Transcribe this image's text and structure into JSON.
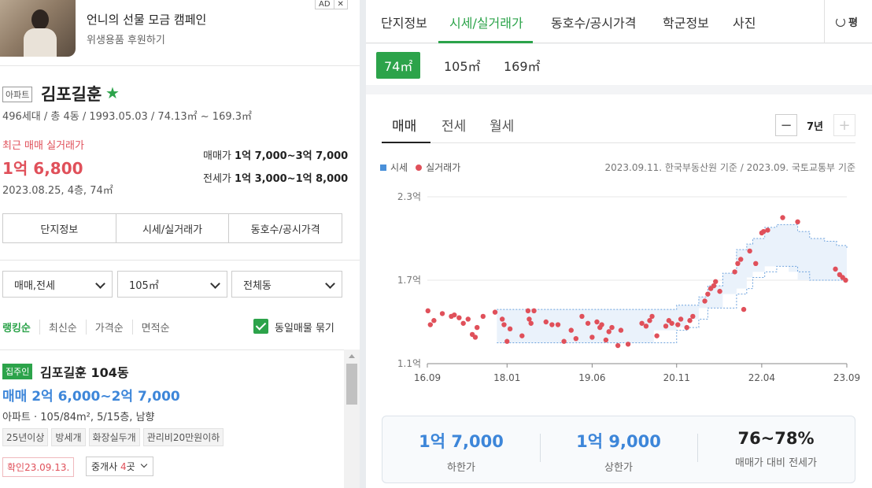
{
  "ad": {
    "title": "언니의 선물 모금 캠페인",
    "subtitle": "위생용품 후원하기",
    "ad_label": "AD",
    "close": "✕"
  },
  "complex": {
    "type_tag": "아파트",
    "name": "김포길훈",
    "star": "★",
    "info": "496세대 / 총 4동 / 1993.05.03 / 74.13㎡ ~ 169.3㎡",
    "recent_label": "최근 매매 실거래가",
    "recent_price": "1억 6,800",
    "recent_date": "2023.08.25, 4층, 74㎡",
    "sale_label": "매매가",
    "sale_range": "1억 7,000~3억 7,000",
    "jeonse_label": "전세가",
    "jeonse_range": "1억 3,000~1억 8,000"
  },
  "section_tabs": [
    "단지정보",
    "시세/실거래가",
    "동호수/공시가격"
  ],
  "filters": {
    "trade": "매매,전세",
    "area": "105㎡",
    "dong": "전체동"
  },
  "sort": {
    "options": [
      "랭킹순",
      "최신순",
      "가격순",
      "면적순"
    ],
    "active": 0,
    "group_label": "동일매물 묶기",
    "group_checked": true
  },
  "listing": {
    "badge": "집주인",
    "title": "김포길훈 104동",
    "price": "매매 2억 6,000~2억 7,000",
    "spec": "아파트 · 105/84m², 5/15층, 남향",
    "chips": [
      "25년이상",
      "방세개",
      "화장실두개",
      "관리비20만원이하"
    ],
    "confirm": "확인23.09.13.",
    "broker_prefix": "중개사 ",
    "broker_count": "4",
    "broker_suffix": "곳"
  },
  "right_tabs": {
    "items": [
      "단지정보",
      "시세/실거래가",
      "동호수/공시가격",
      "학군정보",
      "사진"
    ],
    "active": 1,
    "unit_toggle": "평"
  },
  "areas": {
    "items": [
      "74㎡",
      "105㎡",
      "169㎡"
    ],
    "active": 0
  },
  "chart_panel": {
    "tabs": [
      "매매",
      "전세",
      "월세"
    ],
    "active": 0,
    "minus": "−",
    "period": "7년",
    "plus": "+",
    "legend_price": "시세",
    "legend_trade": "실거래가",
    "source": "2023.09.11. 한국부동산원 기준 / 2023.09. 국토교통부 기준"
  },
  "summary": {
    "low_value": "1억 7,000",
    "low_label": "하한가",
    "high_value": "1억 9,000",
    "high_label": "상한가",
    "ratio_value": "76~78%",
    "ratio_label": "매매가 대비 전세가"
  },
  "colors": {
    "accent": "#2ca34a",
    "price_red": "#e0505a",
    "price_blue": "#3d86d9"
  },
  "chart_data": {
    "type": "scatter",
    "title": "",
    "xlabel": "",
    "ylabel": "",
    "x_ticks": [
      2016.67,
      2018.0,
      2019.42,
      2020.83,
      2022.25,
      2023.67
    ],
    "x_tick_labels": [
      "16.09",
      "18.01",
      "19.06",
      "20.11",
      "22.04",
      "23.09"
    ],
    "y_ticks": [
      1.1,
      1.7,
      2.3
    ],
    "y_tick_labels": [
      "1.1억",
      "1.7억",
      "2.3억"
    ],
    "xlim": [
      2016.67,
      2023.67
    ],
    "ylim": [
      1.1,
      2.3
    ],
    "grid": true,
    "series": [
      {
        "name": "시세",
        "kind": "band",
        "x": [
          2017.83,
          2019.25,
          2019.9,
          2020.45,
          2020.83,
          2021.0,
          2021.2,
          2021.35,
          2021.6,
          2021.83,
          2022.0,
          2022.1,
          2022.3,
          2022.5,
          2022.7,
          2022.85,
          2023.05,
          2023.3,
          2023.5,
          2023.67
        ],
        "upper": [
          1.49,
          1.49,
          1.49,
          1.49,
          1.52,
          1.52,
          1.58,
          1.66,
          1.75,
          1.92,
          1.96,
          2.0,
          2.08,
          2.1,
          2.1,
          2.05,
          2.0,
          1.98,
          1.95,
          1.93
        ],
        "lower": [
          1.25,
          1.25,
          1.25,
          1.25,
          1.34,
          1.36,
          1.42,
          1.5,
          1.5,
          1.6,
          1.64,
          1.72,
          1.76,
          1.8,
          1.8,
          1.76,
          1.7,
          1.7,
          1.7,
          1.7
        ]
      },
      {
        "name": "실거래가",
        "kind": "points",
        "points": [
          [
            2016.68,
            1.48
          ],
          [
            2016.72,
            1.38
          ],
          [
            2016.78,
            1.41
          ],
          [
            2016.92,
            1.46
          ],
          [
            2017.07,
            1.44
          ],
          [
            2017.12,
            1.45
          ],
          [
            2017.2,
            1.43
          ],
          [
            2017.27,
            1.39
          ],
          [
            2017.35,
            1.42
          ],
          [
            2017.42,
            1.31
          ],
          [
            2017.47,
            1.29
          ],
          [
            2017.5,
            1.36
          ],
          [
            2017.6,
            1.44
          ],
          [
            2017.8,
            1.47
          ],
          [
            2017.92,
            1.42
          ],
          [
            2017.95,
            1.38
          ],
          [
            2018.0,
            1.26
          ],
          [
            2018.05,
            1.35
          ],
          [
            2018.25,
            1.3
          ],
          [
            2018.35,
            1.48
          ],
          [
            2018.37,
            1.42
          ],
          [
            2018.4,
            1.39
          ],
          [
            2018.45,
            1.48
          ],
          [
            2018.65,
            1.4
          ],
          [
            2018.75,
            1.38
          ],
          [
            2018.85,
            1.38
          ],
          [
            2018.95,
            1.26
          ],
          [
            2019.07,
            1.34
          ],
          [
            2019.15,
            1.28
          ],
          [
            2019.25,
            1.44
          ],
          [
            2019.35,
            1.39
          ],
          [
            2019.42,
            1.29
          ],
          [
            2019.5,
            1.4
          ],
          [
            2019.55,
            1.36
          ],
          [
            2019.58,
            1.38
          ],
          [
            2019.65,
            1.27
          ],
          [
            2019.7,
            1.33
          ],
          [
            2019.75,
            1.36
          ],
          [
            2019.85,
            1.23
          ],
          [
            2019.9,
            1.34
          ],
          [
            2020.02,
            1.24
          ],
          [
            2020.25,
            1.39
          ],
          [
            2020.32,
            1.37
          ],
          [
            2020.38,
            1.41
          ],
          [
            2020.42,
            1.44
          ],
          [
            2020.5,
            1.3
          ],
          [
            2020.65,
            1.37
          ],
          [
            2020.7,
            1.41
          ],
          [
            2020.75,
            1.39
          ],
          [
            2020.85,
            1.38
          ],
          [
            2020.9,
            1.42
          ],
          [
            2021.0,
            1.36
          ],
          [
            2021.05,
            1.41
          ],
          [
            2021.1,
            1.44
          ],
          [
            2021.3,
            1.55
          ],
          [
            2021.35,
            1.6
          ],
          [
            2021.4,
            1.64
          ],
          [
            2021.45,
            1.66
          ],
          [
            2021.48,
            1.69
          ],
          [
            2021.55,
            1.62
          ],
          [
            2021.8,
            1.76
          ],
          [
            2021.85,
            1.82
          ],
          [
            2021.9,
            1.85
          ],
          [
            2021.95,
            1.49
          ],
          [
            2022.05,
            1.91
          ],
          [
            2022.15,
            1.82
          ],
          [
            2022.25,
            2.04
          ],
          [
            2022.28,
            2.05
          ],
          [
            2022.35,
            2.06
          ],
          [
            2022.6,
            2.15
          ],
          [
            2022.85,
            2.12
          ],
          [
            2023.48,
            1.78
          ],
          [
            2023.55,
            1.74
          ],
          [
            2023.6,
            1.72
          ],
          [
            2023.65,
            1.7
          ]
        ]
      }
    ]
  }
}
